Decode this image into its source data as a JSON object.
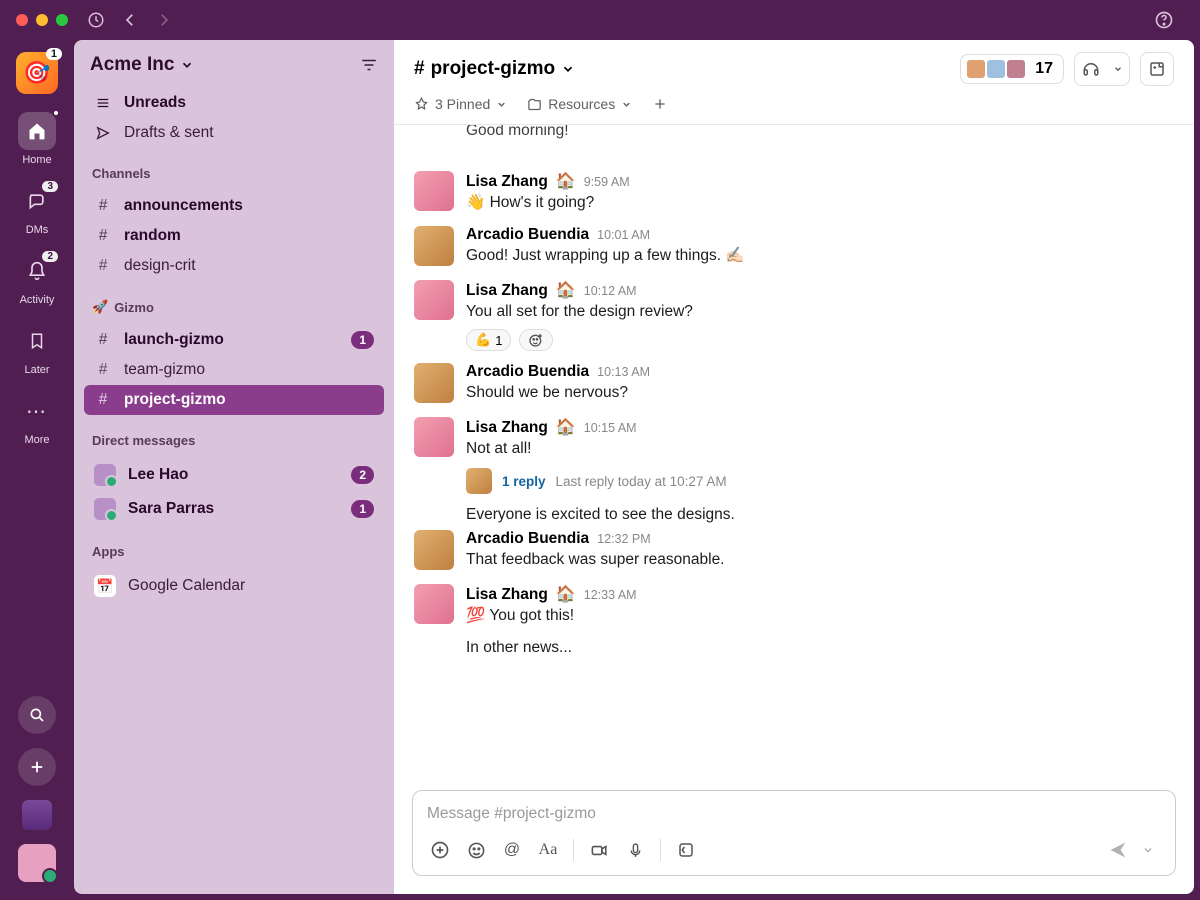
{
  "workspace": {
    "name": "Acme Inc",
    "badge": "1"
  },
  "rail": {
    "home": "Home",
    "dms": "DMs",
    "activity": "Activity",
    "later": "Later",
    "more": "More",
    "dms_badge": "3",
    "activity_badge": "2"
  },
  "sidebar": {
    "unreads": "Unreads",
    "drafts": "Drafts & sent",
    "channels_heading": "Channels",
    "channels": [
      {
        "name": "announcements",
        "bold": true
      },
      {
        "name": "random",
        "bold": true
      },
      {
        "name": "design-crit",
        "bold": false
      }
    ],
    "gizmo_heading": "Gizmo",
    "gizmo": [
      {
        "name": "launch-gizmo",
        "bold": true,
        "badge": "1"
      },
      {
        "name": "team-gizmo",
        "bold": false
      },
      {
        "name": "project-gizmo",
        "active": true
      }
    ],
    "dms_heading": "Direct messages",
    "dms": [
      {
        "name": "Lee Hao",
        "badge": "2"
      },
      {
        "name": "Sara Parras",
        "badge": "1"
      }
    ],
    "apps_heading": "Apps",
    "apps": [
      {
        "name": "Google Calendar",
        "icon": "📅"
      }
    ]
  },
  "channel": {
    "name": "project-gizmo",
    "member_count": "17",
    "pinned": "3 Pinned",
    "resources": "Resources"
  },
  "messages": [
    {
      "author": "",
      "time": "",
      "text": "Good morning!",
      "partial_top": true,
      "av": "b"
    },
    {
      "author": "Lisa Zhang",
      "status": "🏠",
      "time": "9:59 AM",
      "text": "👋 How's it going?",
      "av": "a"
    },
    {
      "author": "Arcadio Buendia",
      "time": "10:01 AM",
      "text": "Good! Just wrapping up a few things. ✍🏻",
      "av": "b"
    },
    {
      "author": "Lisa Zhang",
      "status": "🏠",
      "time": "10:12 AM",
      "text": "You all set for the design review?",
      "av": "a",
      "reactions": [
        {
          "emoji": "💪",
          "count": "1"
        },
        {
          "add": true
        }
      ]
    },
    {
      "author": "Arcadio Buendia",
      "time": "10:13 AM",
      "text": "Should we be nervous?",
      "av": "b"
    },
    {
      "author": "Lisa Zhang",
      "status": "🏠",
      "time": "10:15 AM",
      "text": "Not at all!",
      "av": "a",
      "thread": {
        "replies": "1 reply",
        "last": "Last reply today at 10:27 AM"
      },
      "continuation": "Everyone is excited to see the designs."
    },
    {
      "author": "Arcadio Buendia",
      "time": "12:32 PM",
      "text": "That feedback was super reasonable.",
      "av": "b"
    },
    {
      "author": "Lisa Zhang",
      "status": "🏠",
      "time": "12:33 AM",
      "text": "💯 You got this!",
      "av": "a",
      "continuation": "In other news..."
    }
  ],
  "composer": {
    "placeholder": "Message #project-gizmo"
  }
}
